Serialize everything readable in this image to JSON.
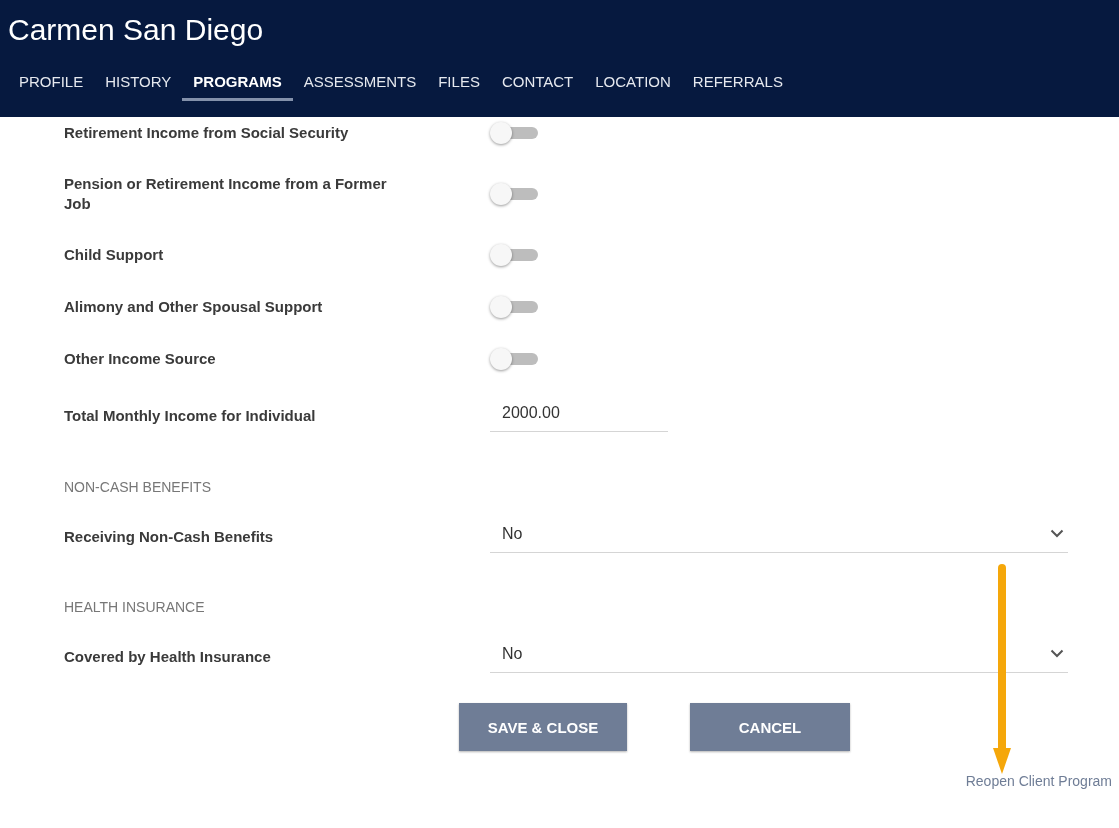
{
  "header": {
    "title": "Carmen San Diego"
  },
  "tabs": [
    {
      "label": "PROFILE",
      "selected": false
    },
    {
      "label": "HISTORY",
      "selected": false
    },
    {
      "label": "PROGRAMS",
      "selected": true
    },
    {
      "label": "ASSESSMENTS",
      "selected": false
    },
    {
      "label": "FILES",
      "selected": false
    },
    {
      "label": "CONTACT",
      "selected": false
    },
    {
      "label": "LOCATION",
      "selected": false
    },
    {
      "label": "REFERRALS",
      "selected": false
    }
  ],
  "form": [
    {
      "kind": "toggle",
      "label": "Retirement Income from Social Security",
      "on": false
    },
    {
      "kind": "toggle",
      "label": "Pension or Retirement Income from a Former Job",
      "on": false
    },
    {
      "kind": "toggle",
      "label": "Child Support",
      "on": false
    },
    {
      "kind": "toggle",
      "label": "Alimony and Other Spousal Support",
      "on": false
    },
    {
      "kind": "toggle",
      "label": "Other Income Source",
      "on": false
    },
    {
      "kind": "input",
      "label": "Total Monthly Income for Individual",
      "value": "2000.00"
    },
    {
      "kind": "heading",
      "label": "NON-CASH BENEFITS"
    },
    {
      "kind": "select",
      "label": "Receiving Non-Cash Benefits",
      "value": "No"
    },
    {
      "kind": "heading",
      "label": "HEALTH INSURANCE"
    },
    {
      "kind": "select",
      "label": "Covered by Health Insurance",
      "value": "No"
    }
  ],
  "buttons": [
    "SAVE & CLOSE",
    "CANCEL"
  ],
  "link": "Reopen Client Program"
}
